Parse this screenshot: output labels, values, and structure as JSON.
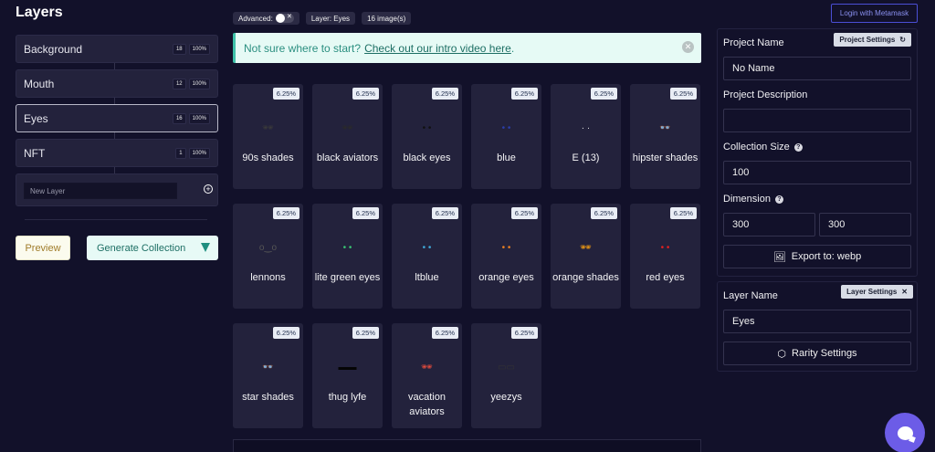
{
  "sidebar": {
    "title": "Layers",
    "layers": [
      {
        "name": "Background",
        "count": "18",
        "percent": "100%",
        "active": false
      },
      {
        "name": "Mouth",
        "count": "12",
        "percent": "100%",
        "active": false
      },
      {
        "name": "Eyes",
        "count": "16",
        "percent": "100%",
        "active": true
      },
      {
        "name": "NFT",
        "count": "1",
        "percent": "100%",
        "active": false
      }
    ],
    "new_layer_placeholder": "New Layer",
    "preview_label": "Preview",
    "generate_label": "Generate Collection"
  },
  "toolbar": {
    "advanced_label": "Advanced:",
    "layer_label": "Layer: Eyes",
    "images_label": "16 image(s)"
  },
  "banner": {
    "text": "Not sure where to start?",
    "link": "Check out our intro video here",
    "tail": "."
  },
  "images": [
    {
      "name": "90s shades",
      "pct": "6.25%",
      "glyph": "🕶",
      "color": "#3a3a3a"
    },
    {
      "name": "black aviators",
      "pct": "6.25%",
      "glyph": "🕶",
      "color": "#2a2a2a"
    },
    {
      "name": "black eyes",
      "pct": "6.25%",
      "glyph": "• •",
      "color": "#111111"
    },
    {
      "name": "blue",
      "pct": "6.25%",
      "glyph": "• •",
      "color": "#2b3ea8"
    },
    {
      "name": "E (13)",
      "pct": "6.25%",
      "glyph": "· ·",
      "color": "#e0e0e0"
    },
    {
      "name": "hipster shades",
      "pct": "6.25%",
      "glyph": "👓",
      "color": "#555555"
    },
    {
      "name": "lennons",
      "pct": "6.25%",
      "glyph": "o‿o",
      "color": "#555555"
    },
    {
      "name": "lite green eyes",
      "pct": "6.25%",
      "glyph": "• •",
      "color": "#38c172"
    },
    {
      "name": "ltblue",
      "pct": "6.25%",
      "glyph": "• •",
      "color": "#3fa7d6"
    },
    {
      "name": "orange eyes",
      "pct": "6.25%",
      "glyph": "• •",
      "color": "#e67e22"
    },
    {
      "name": "orange shades",
      "pct": "6.25%",
      "glyph": "🕶",
      "color": "#f39c12"
    },
    {
      "name": "red eyes",
      "pct": "6.25%",
      "glyph": "• •",
      "color": "#e02020"
    },
    {
      "name": "star shades",
      "pct": "6.25%",
      "glyph": "👓",
      "color": "#e88"
    },
    {
      "name": "thug lyfe",
      "pct": "6.25%",
      "glyph": "▬▬",
      "color": "#050505"
    },
    {
      "name": "vacation aviators",
      "pct": "6.25%",
      "glyph": "🕶",
      "color": "#e74c3c"
    },
    {
      "name": "yeezys",
      "pct": "6.25%",
      "glyph": "▭▭",
      "color": "#333333"
    }
  ],
  "project": {
    "metamask_label": "Login with Metamask",
    "settings_chip": "Project Settings",
    "name_label": "Project Name",
    "name_value": "No Name",
    "description_label": "Project Description",
    "description_value": "",
    "collection_size_label": "Collection Size",
    "collection_size_value": "100",
    "dimension_label": "Dimension",
    "dimension_width": "300",
    "dimension_height": "300",
    "export_label": "Export to: webp"
  },
  "layer_settings": {
    "chip_label": "Layer Settings",
    "name_label": "Layer Name",
    "name_value": "Eyes",
    "rarity_label": "Rarity Settings"
  }
}
